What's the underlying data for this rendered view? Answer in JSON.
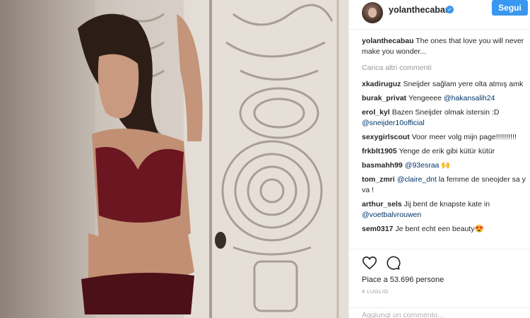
{
  "post": {
    "username": "yolanthecabau",
    "verified_glyph": "✓",
    "follow_label": "Segui",
    "caption_user": "yolanthecabau",
    "caption_text": " The ones that love you will never make you wonder...",
    "load_more_label": "Carica altri commenti",
    "likes_text": "Piace a 53.696 persone",
    "date_text": "4 LUGLIO",
    "add_comment_placeholder": "Aggiungi un commento..."
  },
  "comments": [
    {
      "user": "xkadiruguz",
      "text": "Sneijder sağlam yere olta atmış amk"
    },
    {
      "user": "burak_privat",
      "text": "Yengeeee ",
      "mention": "@hakansalih24"
    },
    {
      "user": "erol_kyl",
      "text": "Bazen Sneijder olmak istersin :D ",
      "mention": "@sneijder10official"
    },
    {
      "user": "sexygirlscout",
      "text": "Voor meer volg mijn page!!!!!!!!!!"
    },
    {
      "user": "frkblt1905",
      "text": "Yenge de erik gibi kütür kütür"
    },
    {
      "user": "basmahh99",
      "mention": "@93esraa",
      "text": " 🙌"
    },
    {
      "user": "tom_zmri",
      "mention": "@claire_dnt",
      "text": " la femme de sneojder sa y va !"
    },
    {
      "user": "arthur_sels",
      "text": "Jij bent de knapste kate in ",
      "mention": "@voetbalvrouwen"
    },
    {
      "user": "sem0317",
      "text": "Je bent echt een beauty😍"
    }
  ],
  "icons": {
    "like": "heart-icon",
    "comment": "comment-bubble-icon",
    "verified": "verified-badge-icon"
  },
  "colors": {
    "accent": "#3897f0",
    "mention": "#003569",
    "muted": "#999999",
    "text": "#262626"
  }
}
